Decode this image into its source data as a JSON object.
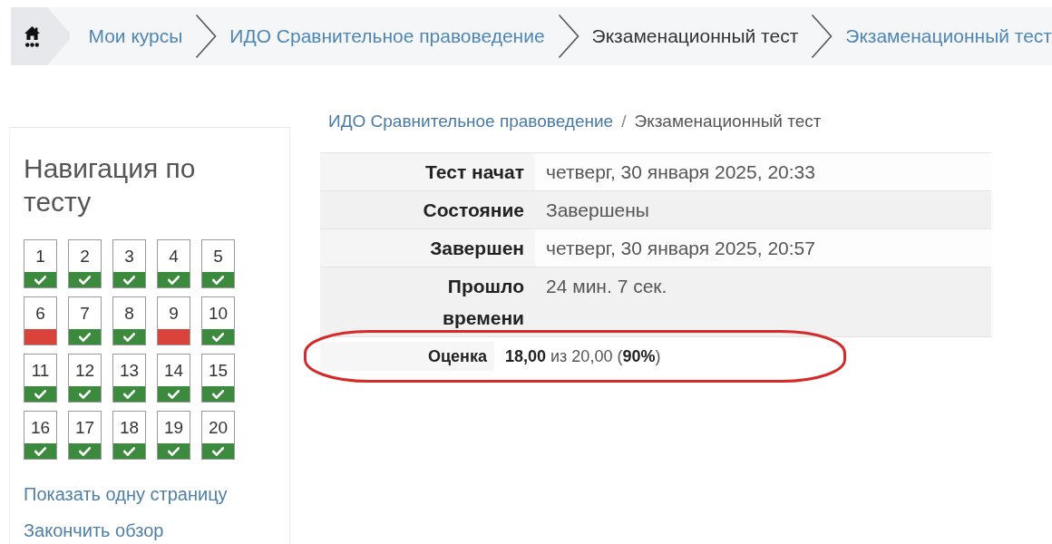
{
  "breadcrumb": {
    "items": [
      {
        "label": "Мои курсы",
        "kind": "link"
      },
      {
        "label": "ИДО Сравнительное правоведение",
        "kind": "link"
      },
      {
        "label": "Экзаменационный тест",
        "kind": "text"
      },
      {
        "label": "Экзаменационный тест",
        "kind": "link"
      }
    ]
  },
  "quiz_navigation": {
    "title": "Навигация по тесту",
    "questions": [
      {
        "number": "1",
        "correct": true
      },
      {
        "number": "2",
        "correct": true
      },
      {
        "number": "3",
        "correct": true
      },
      {
        "number": "4",
        "correct": true
      },
      {
        "number": "5",
        "correct": true
      },
      {
        "number": "6",
        "correct": false
      },
      {
        "number": "7",
        "correct": true
      },
      {
        "number": "8",
        "correct": true
      },
      {
        "number": "9",
        "correct": false
      },
      {
        "number": "10",
        "correct": true
      },
      {
        "number": "11",
        "correct": true
      },
      {
        "number": "12",
        "correct": true
      },
      {
        "number": "13",
        "correct": true
      },
      {
        "number": "14",
        "correct": true
      },
      {
        "number": "15",
        "correct": true
      },
      {
        "number": "16",
        "correct": true
      },
      {
        "number": "17",
        "correct": true
      },
      {
        "number": "18",
        "correct": true
      },
      {
        "number": "19",
        "correct": true
      },
      {
        "number": "20",
        "correct": true
      }
    ],
    "links": [
      "Показать одну страницу",
      "Закончить обзор"
    ]
  },
  "page_breadcrumb": {
    "items": [
      {
        "label": "ИДО Сравнительное правоведение",
        "kind": "link"
      },
      {
        "label": "Экзаменационный тест",
        "kind": "text"
      }
    ],
    "separator": "/"
  },
  "summary": {
    "rows": [
      {
        "label": "Тест начат",
        "value": "четверг, 30 января 2025, 20:33"
      },
      {
        "label": "Состояние",
        "value": "Завершены"
      },
      {
        "label": "Завершен",
        "value": "четверг, 30 января 2025, 20:57"
      },
      {
        "label": "Прошло времени",
        "value": "24 мин. 7 сек."
      }
    ]
  },
  "grade": {
    "label": "Оценка",
    "value": "**18,00** из 20,00 (**90%**)",
    "highlighted": true
  }
}
